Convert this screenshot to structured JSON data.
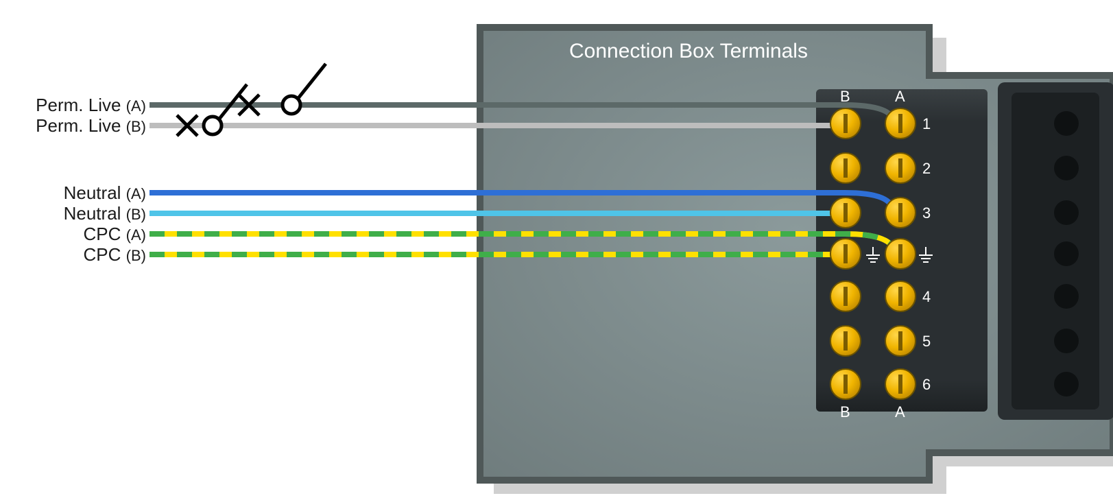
{
  "title": "Connection Box Terminals",
  "wires": [
    {
      "id": "perm-live-a",
      "label": "Perm. Live",
      "suffix": "(A)"
    },
    {
      "id": "perm-live-b",
      "label": "Perm. Live",
      "suffix": "(B)"
    },
    {
      "id": "neutral-a",
      "label": "Neutral",
      "suffix": "(A)"
    },
    {
      "id": "neutral-b",
      "label": "Neutral",
      "suffix": "(B)"
    },
    {
      "id": "cpc-a",
      "label": "CPC",
      "suffix": "(A)"
    },
    {
      "id": "cpc-b",
      "label": "CPC",
      "suffix": "(B)"
    }
  ],
  "columns": {
    "left": "B",
    "right": "A"
  },
  "rows": [
    "1",
    "2",
    "3",
    "⏚",
    "4",
    "5",
    "6"
  ],
  "colors": {
    "liveA": "#5c6968",
    "liveB": "#bdbdbd",
    "neutralA": "#2e6fd6",
    "neutralB": "#4fc4e8",
    "cpcY": "#ffe000",
    "cpcG": "#3fae49",
    "boxFill": "#8b9a9b",
    "boxStroke": "#4f5858",
    "blockFill": "#2a2f32",
    "blockHi": "#3a4043",
    "term": "#f0b400",
    "termHi": "#ffd64a",
    "termStroke": "#6b5300",
    "shadow": "#b8b8b8"
  }
}
